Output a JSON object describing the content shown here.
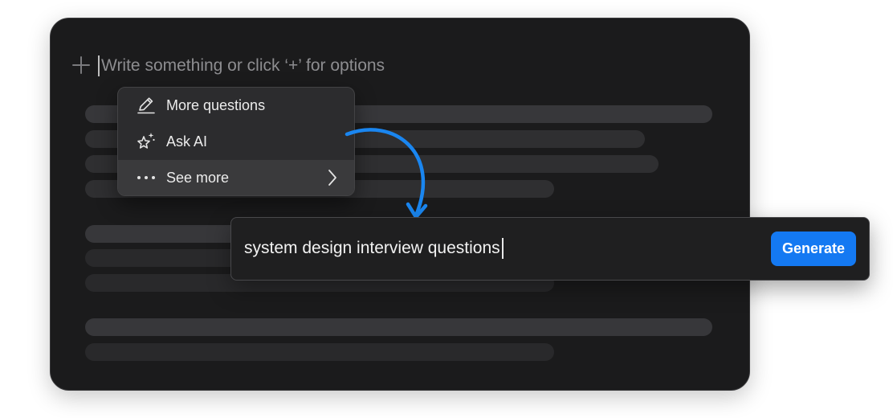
{
  "editor": {
    "placeholder": "Write something or click ‘+’ for options"
  },
  "menu": {
    "items": [
      {
        "label": "More questions",
        "icon": "pencil-icon"
      },
      {
        "label": "Ask AI",
        "icon": "sparkle-star-icon"
      },
      {
        "label": "See more",
        "icon": "more-dots-icon",
        "submenu_icon": "chevron-right-icon"
      }
    ]
  },
  "prompt": {
    "value": "system design interview questions",
    "button_label": "Generate"
  },
  "colors": {
    "accent": "#1479f2",
    "editor_background": "#1b1b1c",
    "arrow": "#1a86f0"
  }
}
